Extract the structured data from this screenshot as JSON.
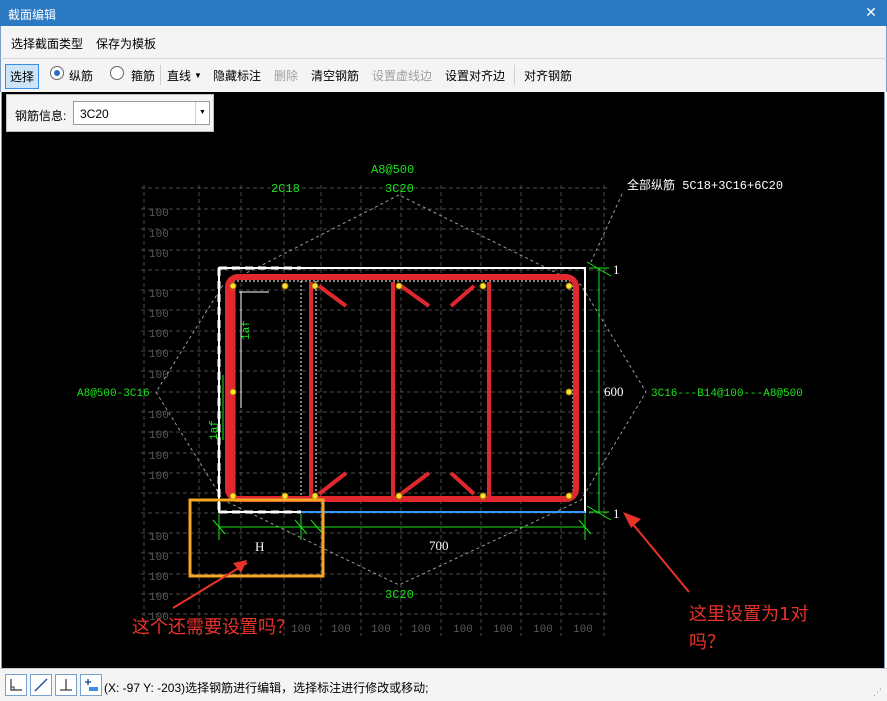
{
  "window": {
    "title": "截面编辑",
    "close_label": "✕"
  },
  "menu": {
    "items": [
      "选择截面类型",
      "保存为模板"
    ]
  },
  "toolbar": {
    "select_label": "选择",
    "radio_longitudinal": "纵筋",
    "radio_stirrup": "箍筋",
    "line_label": "直线",
    "hide_label": "隐藏标注",
    "delete_label": "删除",
    "clear_label": "清空钢筋",
    "dashed_edge_label": "设置虚线边",
    "align_edge_label": "设置对齐边",
    "align_rebar_label": "对齐钢筋"
  },
  "rebar_info": {
    "label": "钢筋信息:",
    "value": "3C20"
  },
  "drawing": {
    "grid_label": "100",
    "top_stirrup": "A8@500",
    "top_left_rebar": "2C18",
    "top_mid_rebar": "3C20",
    "bottom_rebar": "3C20",
    "left_side": "A8@500-3C16",
    "right_side": "3C16---B14@100---A8@500",
    "all_longitudinal": "全部纵筋  5C18+3C16+6C20",
    "width_dim": "700",
    "height_dim": "600",
    "h_label": "H",
    "top_tick": "1",
    "bottom_tick": "1",
    "vert_dim_a": "1af",
    "vert_dim_b": "1af",
    "note_left": "这个还需要设置吗？",
    "note_right_1": "这里设置为1对",
    "note_right_2": "吗？"
  },
  "colors": {
    "title_bar": "#2b79c2",
    "rebar": "#e0282e",
    "dim_green": "#19e619",
    "highlight_box": "#f5a623",
    "annotation_red": "#e8332a",
    "bottom_edge": "#3399ff"
  },
  "status": {
    "text": "(X: -97 Y: -203)选择钢筋进行编辑，选择标注进行修改或移动;"
  }
}
